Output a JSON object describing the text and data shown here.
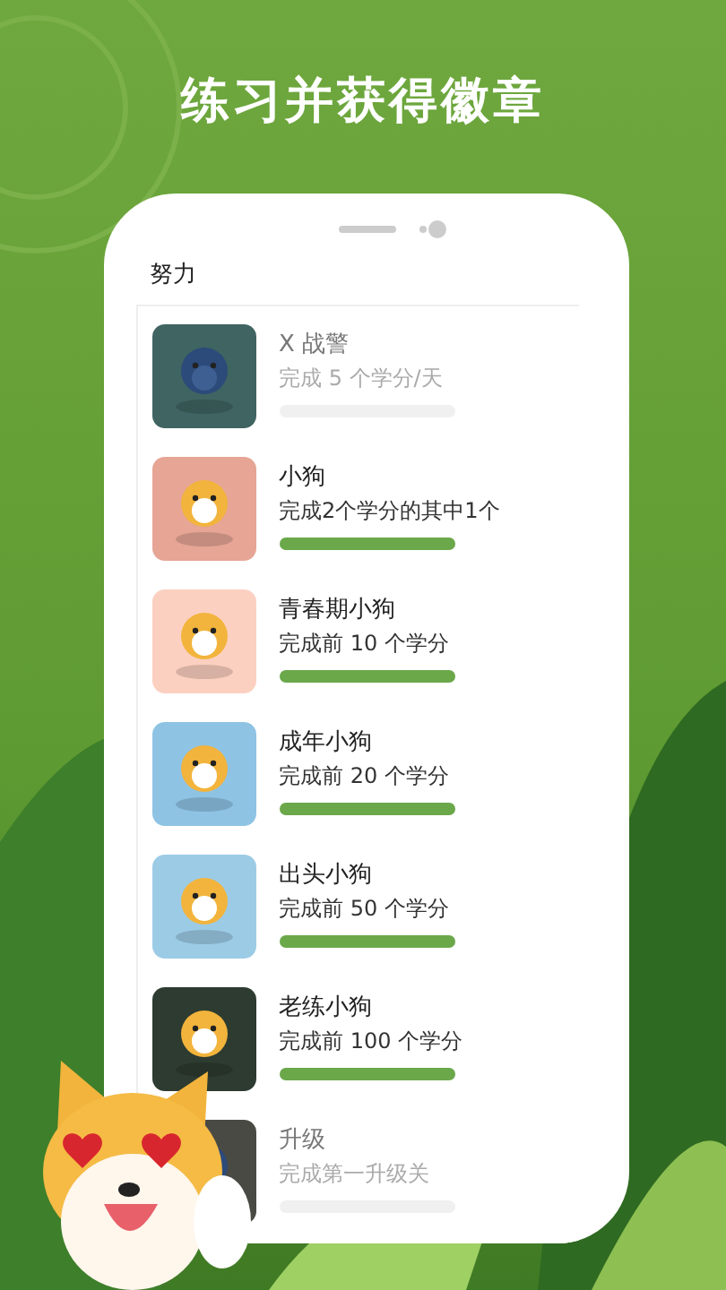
{
  "headline": "练习并获得徽章",
  "section": {
    "title": "努力"
  },
  "badges": [
    {
      "name": "X 战警",
      "requirement": "完成 5 个学分/天",
      "locked": true,
      "color": "#3f6461"
    },
    {
      "name": "小狗",
      "requirement": "完成2个学分的其中1个",
      "locked": false,
      "level": 1,
      "color": "#e6a595"
    },
    {
      "name": "青春期小狗",
      "requirement": "完成前 10 个学分",
      "locked": false,
      "level": 1,
      "color": "#fcd0c0"
    },
    {
      "name": "成年小狗",
      "requirement": "完成前 20 个学分",
      "locked": false,
      "level": 1,
      "color": "#8ec3e4"
    },
    {
      "name": "出头小狗",
      "requirement": "完成前 50 个学分",
      "locked": false,
      "level": 1,
      "color": "#9ccbe6"
    },
    {
      "name": "老练小狗",
      "requirement": "完成前 100 个学分",
      "locked": false,
      "level": 1,
      "color": "#2d3b30"
    },
    {
      "name": "升级",
      "requirement": "完成第一升级关",
      "locked": true,
      "color": "#4a4a44"
    }
  ]
}
